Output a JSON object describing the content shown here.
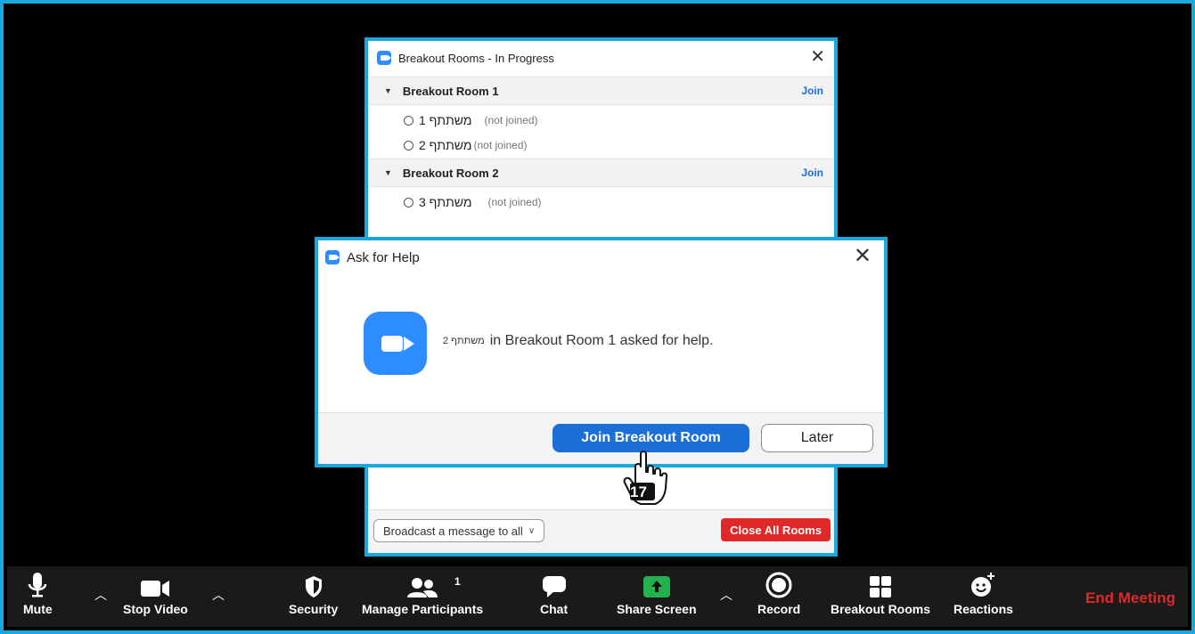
{
  "breakout_panel": {
    "title": "Breakout Rooms - In Progress",
    "rooms": [
      {
        "name": "Breakout Room 1",
        "join_label": "Join",
        "participants": [
          {
            "name": "משתתף 1",
            "status": "(not joined)"
          },
          {
            "name": "משתתף 2",
            "status": "(not joined)"
          }
        ]
      },
      {
        "name": "Breakout Room 2",
        "join_label": "Join",
        "participants": [
          {
            "name": "משתתף 3",
            "status": "(not joined)"
          }
        ]
      }
    ],
    "broadcast_label": "Broadcast a message to all",
    "close_all_label": "Close All Rooms"
  },
  "help_dialog": {
    "title": "Ask for Help",
    "requester": "משתתף 2",
    "message": "in Breakout Room 1 asked for help.",
    "join_button": "Join Breakout Room",
    "later_button": "Later"
  },
  "step_number": "17",
  "toolbar": {
    "mute": "Mute",
    "stop_video": "Stop Video",
    "security": "Security",
    "manage_participants": "Manage Participants",
    "participant_count": "1",
    "chat": "Chat",
    "share_screen": "Share Screen",
    "record": "Record",
    "breakout_rooms": "Breakout Rooms",
    "reactions": "Reactions",
    "end_meeting": "End Meeting"
  },
  "colors": {
    "accent_border": "#1aa7dd",
    "zoom_blue": "#2d8cff",
    "join_blue": "#1c6fd6",
    "danger_red": "#e02828",
    "share_green": "#23b14d"
  }
}
